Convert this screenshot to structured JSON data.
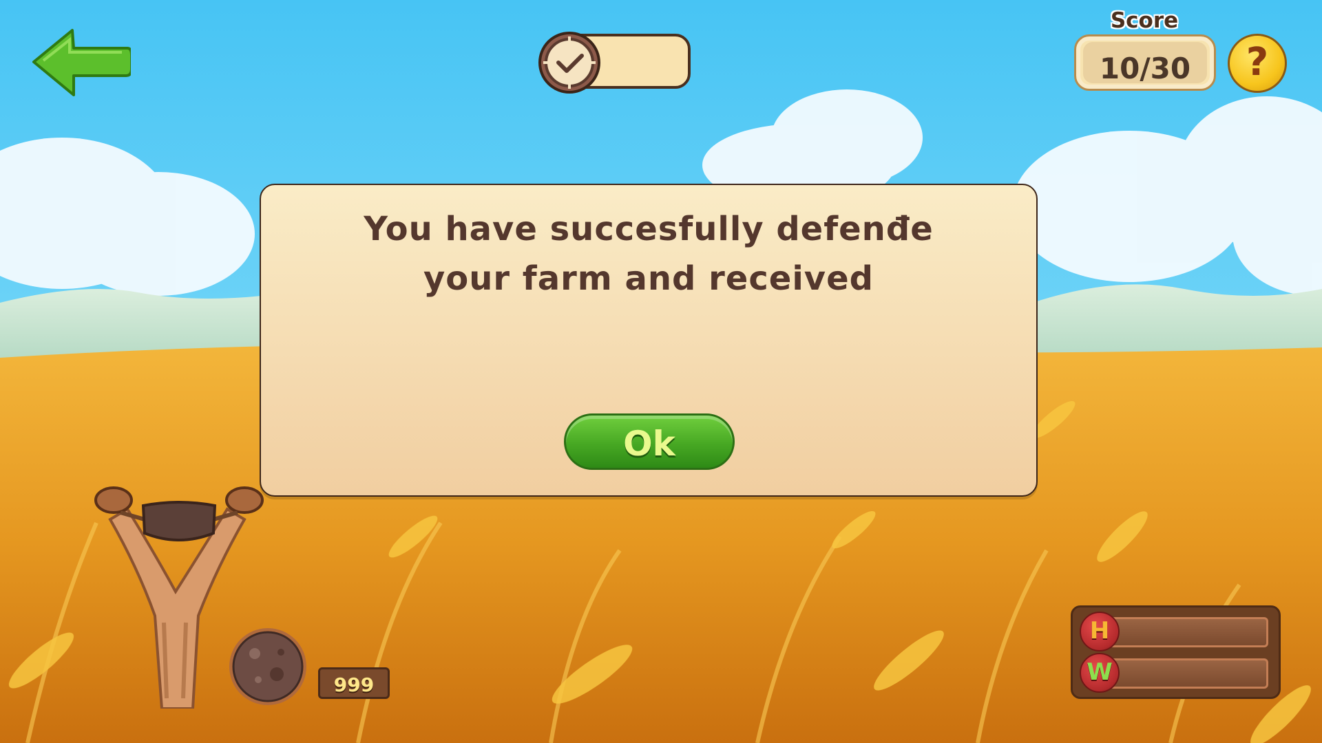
{
  "header": {
    "back_button_label": "",
    "timer_value": "",
    "score_label": "Score",
    "score_value": "10/30",
    "help_glyph": "?"
  },
  "dialog": {
    "message": "You have succesfully defenđe your farm and received",
    "ok_label": "Ok"
  },
  "ammo": {
    "count": "999"
  },
  "status_bars": [
    {
      "letter": "H",
      "level": 0
    },
    {
      "letter": "W",
      "level": 0
    }
  ],
  "colors": {
    "sky": "#5fcff5",
    "wheat": "#e69a1f",
    "dialog_bg": "#f6dfb4",
    "ok_green": "#4caa24",
    "text_brown": "#54372d",
    "help_yellow": "#f7c51d"
  },
  "icons": {
    "back": "green-left-arrow-icon",
    "timer": "clock-icon",
    "help": "question-mark-icon",
    "ammo": "stone-ball-icon",
    "weapon": "slingshot-icon",
    "bar_h": "h-badge-icon",
    "bar_w": "w-badge-icon"
  }
}
